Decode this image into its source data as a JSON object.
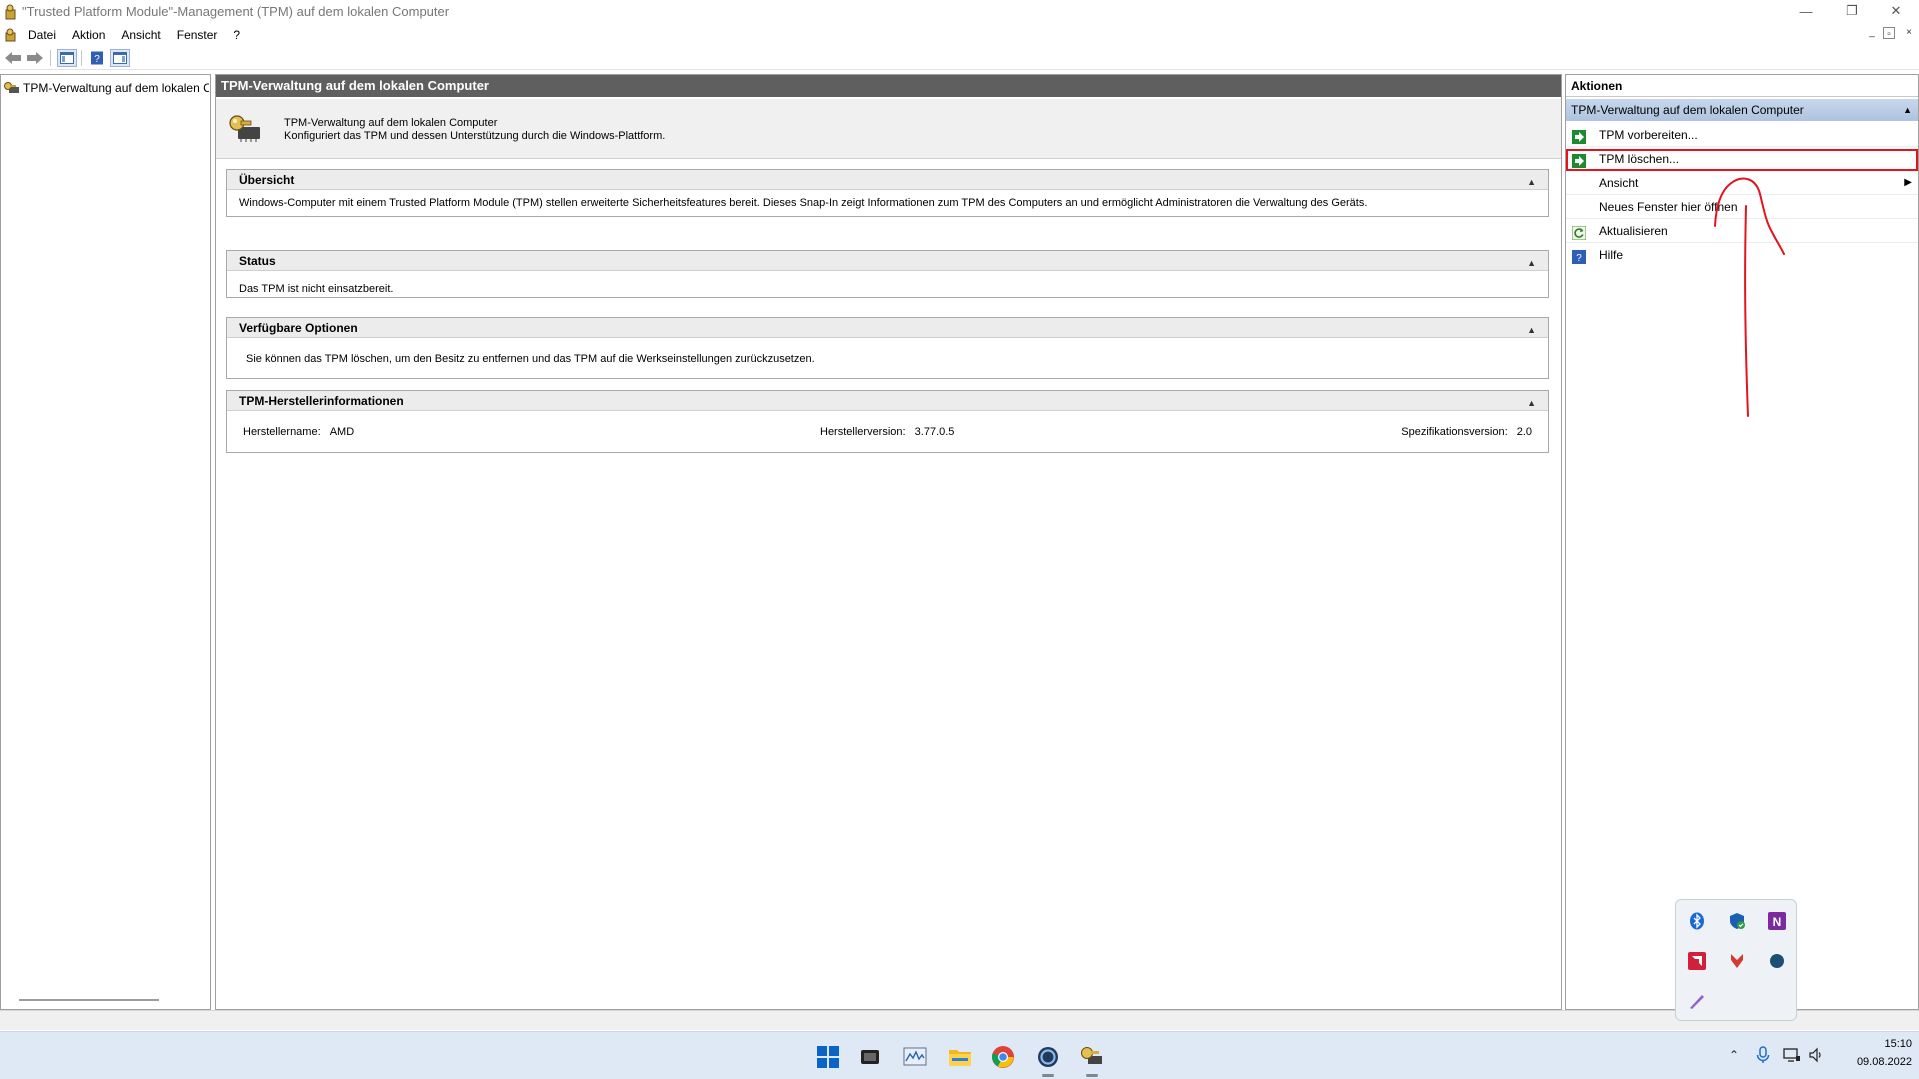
{
  "window": {
    "title": "\"Trusted Platform Module\"-Management (TPM) auf dem lokalen Computer",
    "minimize_glyph": "—",
    "restore_glyph": "❐",
    "close_glyph": "✕"
  },
  "menu": {
    "items": [
      {
        "label": "Datei"
      },
      {
        "label": "Aktion"
      },
      {
        "label": "Ansicht"
      },
      {
        "label": "Fenster"
      },
      {
        "label": "?"
      }
    ],
    "mdi": {
      "minimize": "_",
      "restore": "▫",
      "close": "×"
    }
  },
  "tree": {
    "item_label": "TPM-Verwaltung auf dem lokalen Computer"
  },
  "center": {
    "header": "TPM-Verwaltung auf dem lokalen Computer",
    "desc_title": "TPM-Verwaltung auf dem lokalen Computer",
    "desc_text": "Konfiguriert das TPM und dessen Unterstützung durch die Windows-Plattform.",
    "sections": {
      "overview": {
        "title": "Übersicht",
        "text": "Windows-Computer mit einem Trusted Platform Module (TPM) stellen erweiterte Sicherheitsfeatures bereit. Dieses Snap-In zeigt Informationen zum TPM des Computers an und ermöglicht Administratoren die Verwaltung des Geräts."
      },
      "status": {
        "title": "Status",
        "text": "Das TPM ist nicht einsatzbereit."
      },
      "options": {
        "title": "Verfügbare Optionen",
        "text": "Sie können das TPM löschen, um den Besitz zu entfernen und das TPM auf die Werkseinstellungen zurückzusetzen."
      },
      "manufacturer": {
        "title": "TPM-Herstellerinformationen",
        "name_label": "Herstellername:",
        "name_value": "AMD",
        "version_label": "Herstellerversion:",
        "version_value": "3.77.0.5",
        "spec_label": "Spezifikationsversion:",
        "spec_value": "2.0"
      }
    }
  },
  "actions": {
    "title": "Aktionen",
    "group": "TPM-Verwaltung auf dem lokalen Computer",
    "items": [
      {
        "label": "TPM vorbereiten...",
        "icon": "green-action-icon"
      },
      {
        "label": "TPM löschen...",
        "icon": "green-action-icon",
        "highlighted": true
      },
      {
        "label": "Ansicht",
        "icon": "",
        "submenu": true
      },
      {
        "label": "Neues Fenster hier öffnen",
        "icon": ""
      },
      {
        "label": "Aktualisieren",
        "icon": "refresh-icon"
      },
      {
        "label": "Hilfe",
        "icon": "help-icon"
      }
    ],
    "annotation_color": "#e3141b"
  },
  "taskbar": {
    "apps": [
      "start-icon",
      "task-view-icon",
      "performance-monitor-icon",
      "file-explorer-icon",
      "chrome-icon",
      "cortana-icon",
      "tpm-console-icon"
    ],
    "clock_time": "15:10",
    "clock_date": "09.08.2022"
  },
  "tray_overflow": {
    "icons": [
      "bluetooth-icon",
      "defender-icon",
      "onenote-icon",
      "amd-icon",
      "red-arrow-app-icon",
      "dark-circle-icon",
      "pen-icon"
    ]
  }
}
